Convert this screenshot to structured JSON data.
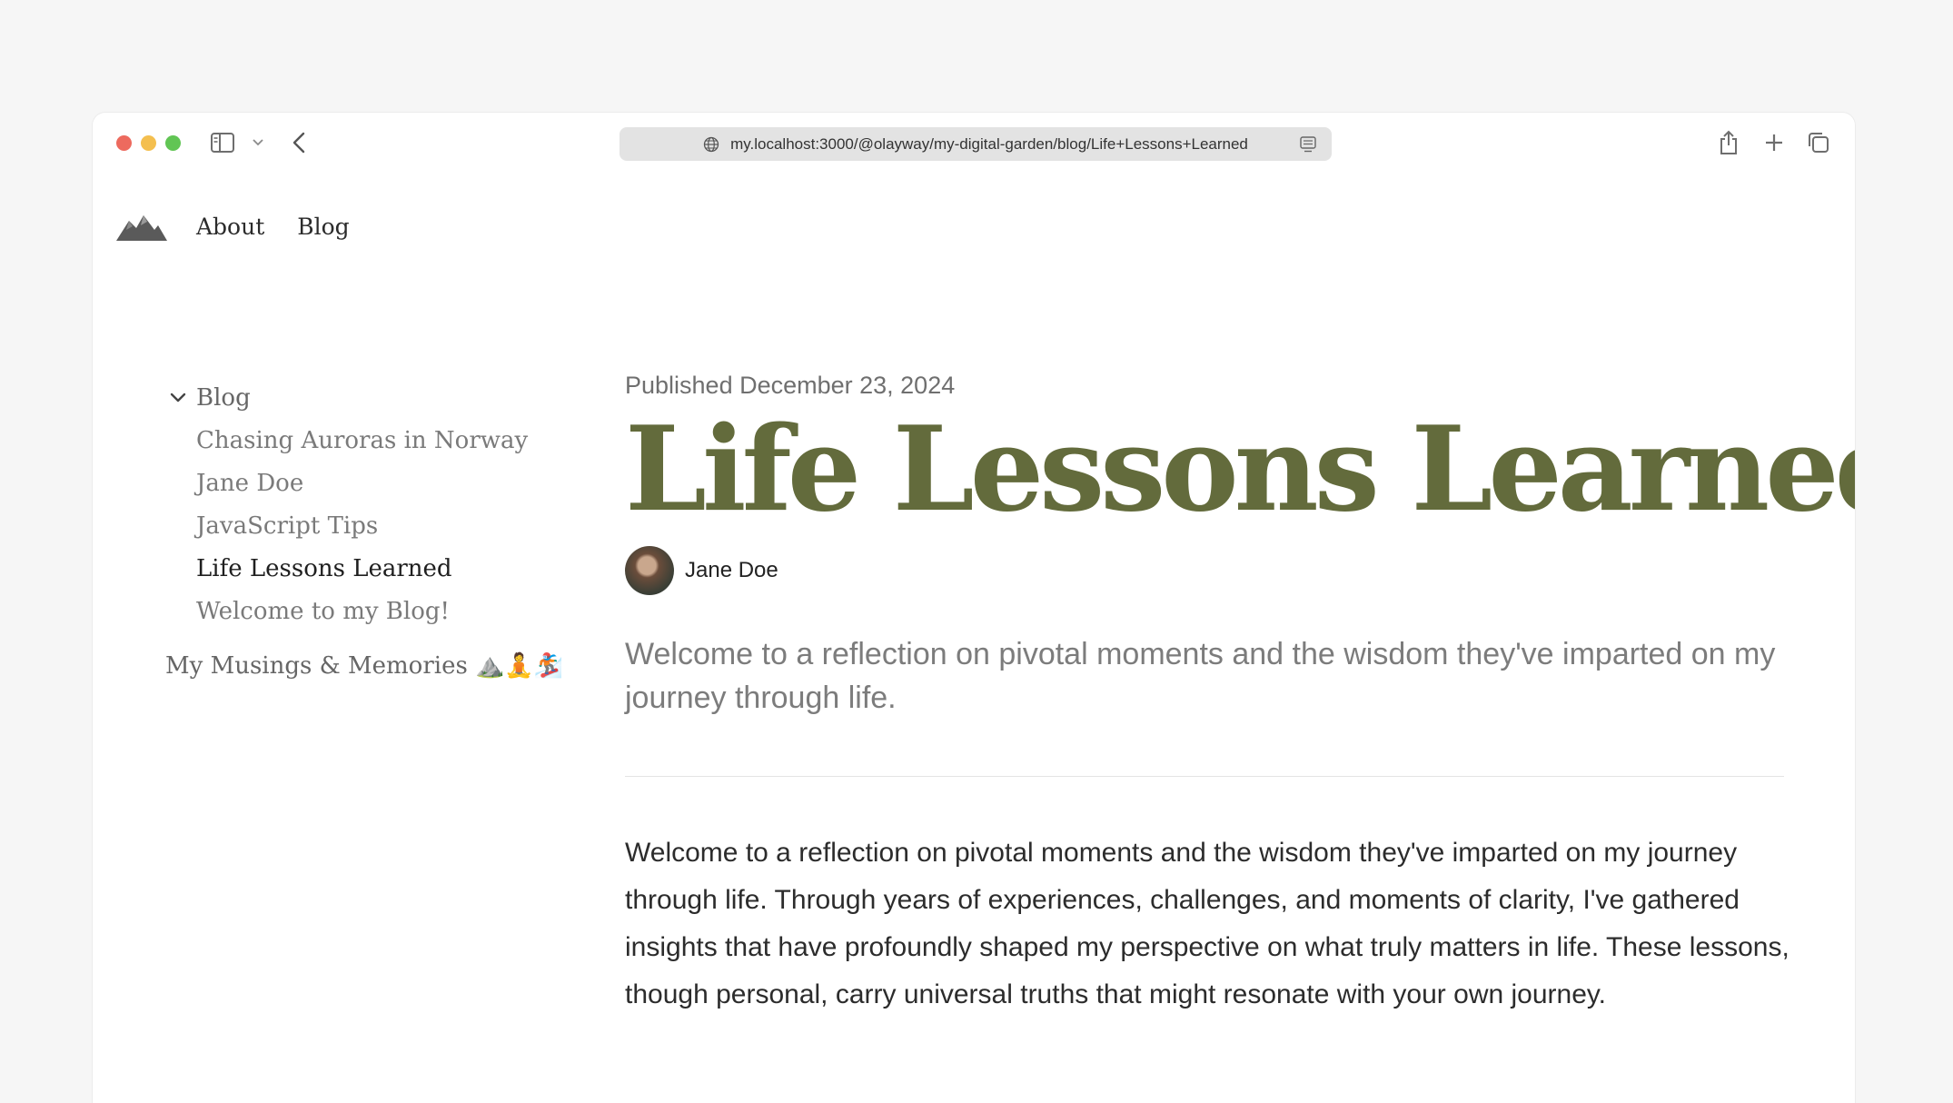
{
  "browser": {
    "url": "my.localhost:3000/@olayway/my-digital-garden/blog/Life+Lessons+Learned"
  },
  "site_nav": {
    "logo_icon": "mountains-logo-icon",
    "links": [
      {
        "label": "About"
      },
      {
        "label": "Blog"
      }
    ]
  },
  "sidebar": {
    "group_label": "Blog",
    "items": [
      {
        "label": "Chasing Auroras in Norway"
      },
      {
        "label": "Jane Doe"
      },
      {
        "label": "JavaScript Tips"
      },
      {
        "label": "Life Lessons Learned",
        "active": true
      },
      {
        "label": "Welcome to my Blog!"
      }
    ],
    "root_item": "My Musings & Memories ⛰️🧘🏂"
  },
  "article": {
    "published": "Published December 23, 2024",
    "title": "Life Lessons Learned",
    "author": "Jane Doe",
    "summary": "Welcome to a reflection on pivotal moments and the wisdom they've imparted on my journey through life.",
    "body": "Welcome to a reflection on pivotal moments and the wisdom they've imparted on my journey through life. Through years of experiences, challenges, and moments of clarity, I've gathered insights that have profoundly shaped my perspective on what truly matters in life. These lessons, though personal, carry universal truths that might resonate with your own journey."
  },
  "colors": {
    "title": "#636b3c",
    "traffic_red": "#ed6a5e",
    "traffic_yellow": "#f4bf4f",
    "traffic_green": "#61c554"
  }
}
